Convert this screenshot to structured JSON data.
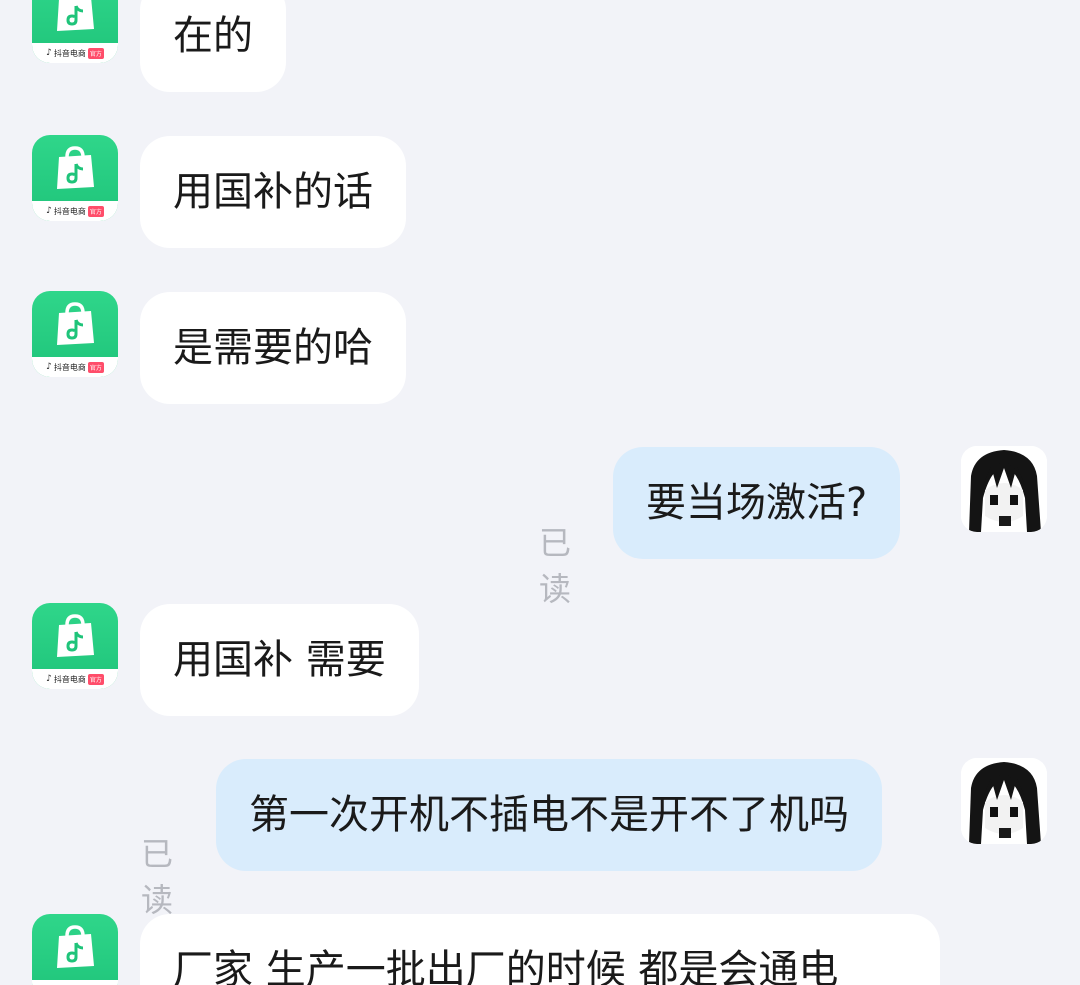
{
  "shop": {
    "avatar_label": "抖音电商",
    "avatar_badge": "官方"
  },
  "messages": [
    {
      "from": "shop",
      "text": "在的"
    },
    {
      "from": "shop",
      "text": "用国补的话"
    },
    {
      "from": "shop",
      "text": "是需要的哈"
    },
    {
      "from": "me",
      "text": "要当场激活?",
      "status": "已读"
    },
    {
      "from": "shop",
      "text": "用国补 需要"
    },
    {
      "from": "me",
      "text": "第一次开机不插电不是开不了机吗",
      "status": "已读"
    },
    {
      "from": "shop",
      "text": "厂家 生产一批出厂的时候 都是会通电"
    }
  ],
  "colors": {
    "background": "#f2f3f8",
    "incoming_bubble": "#ffffff",
    "outgoing_bubble": "#d9ecfc",
    "shop_avatar": "#1fc47a",
    "read_status": "#b6b8bf"
  },
  "icons": {
    "shop_avatar": "douyin-shop-bag-icon",
    "user_avatar": "anime-girl-avatar"
  }
}
